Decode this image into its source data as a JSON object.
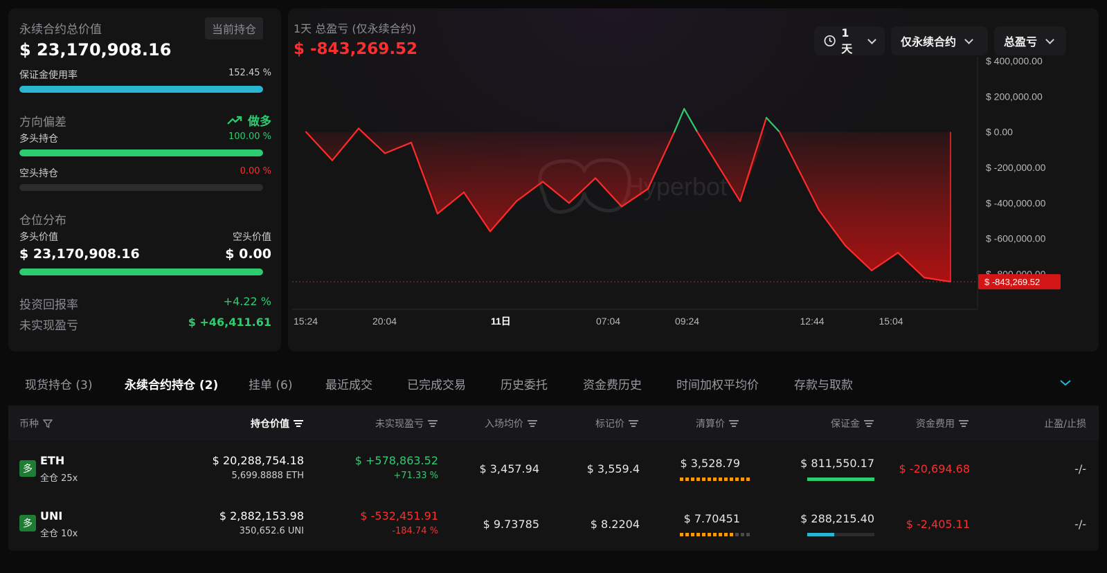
{
  "summary": {
    "total_value_label": "永续合约总价值",
    "current_position_tag": "当前持仓",
    "total_value": "$ 23,170,908.16",
    "margin_usage_label": "保证金使用率",
    "margin_usage_value": "152.45 %",
    "margin_usage_fill": 1.0,
    "bias_label": "方向偏差",
    "bias_value": "做多",
    "long_label": "多头持仓",
    "long_pct": "100.00 %",
    "long_fill": 1.0,
    "short_label": "空头持仓",
    "short_pct": "0.00 %",
    "short_fill": 0.0,
    "distribution_label": "仓位分布",
    "long_value_label": "多头价值",
    "short_value_label": "空头价值",
    "long_value": "$ 23,170,908.16",
    "short_value": "$ 0.00",
    "distribution_fill": 1.0,
    "roi_label": "投资回报率",
    "roi_value": "+4.22 %",
    "upnl_label": "未实现盈亏",
    "upnl_value": "$ +46,411.61"
  },
  "chart_header": {
    "subtitle": "1天 总盈亏 (仅永续合约)",
    "pnl_value": "$ -843,269.52",
    "period_label": "1天",
    "scope_label": "仅永续合约",
    "metric_label": "总盈亏",
    "watermark": "Hyperbot",
    "current_marker": "$ -843,269.52"
  },
  "chart_data": {
    "type": "area",
    "title": "1天 总盈亏 (仅永续合约)",
    "ylim": [
      -800000,
      400000
    ],
    "y_ticks": [
      "$ 400,000.00",
      "$ 200,000.00",
      "$ 0.00",
      "$ -200,000.00",
      "$ -400,000.00",
      "$ -600,000.00",
      "$ -800,000.00"
    ],
    "y_tick_values": [
      400000,
      200000,
      0,
      -200000,
      -400000,
      -600000,
      -800000
    ],
    "x_ticks": [
      "15:24",
      "20:04",
      "11日",
      "07:04",
      "09:24",
      "12:44",
      "15:04"
    ],
    "x_tick_positions": [
      0,
      0.12,
      0.3,
      0.46,
      0.58,
      0.77,
      0.89
    ],
    "baseline": -843269.52,
    "points": [
      {
        "x": 0.0,
        "y": 0
      },
      {
        "x": 0.04,
        "y": -160000
      },
      {
        "x": 0.08,
        "y": 20000
      },
      {
        "x": 0.12,
        "y": -120000
      },
      {
        "x": 0.16,
        "y": -60000
      },
      {
        "x": 0.2,
        "y": -460000
      },
      {
        "x": 0.24,
        "y": -340000
      },
      {
        "x": 0.28,
        "y": -560000
      },
      {
        "x": 0.32,
        "y": -390000
      },
      {
        "x": 0.36,
        "y": -280000
      },
      {
        "x": 0.4,
        "y": -400000
      },
      {
        "x": 0.44,
        "y": -260000
      },
      {
        "x": 0.48,
        "y": -420000
      },
      {
        "x": 0.52,
        "y": -320000
      },
      {
        "x": 0.56,
        "y": 0
      },
      {
        "x": 0.575,
        "y": 130000
      },
      {
        "x": 0.595,
        "y": 0
      },
      {
        "x": 0.66,
        "y": -390000
      },
      {
        "x": 0.7,
        "y": 80000
      },
      {
        "x": 0.72,
        "y": 0
      },
      {
        "x": 0.78,
        "y": -440000
      },
      {
        "x": 0.82,
        "y": -640000
      },
      {
        "x": 0.86,
        "y": -780000
      },
      {
        "x": 0.9,
        "y": -680000
      },
      {
        "x": 0.94,
        "y": -820000
      },
      {
        "x": 0.98,
        "y": -843269.52
      }
    ]
  },
  "tabs": [
    {
      "label": "现货持仓 (3)"
    },
    {
      "label": "永续合约持仓 (2)"
    },
    {
      "label": "挂单 (6)"
    },
    {
      "label": "最近成交"
    },
    {
      "label": "已完成交易"
    },
    {
      "label": "历史委托"
    },
    {
      "label": "资金费历史"
    },
    {
      "label": "时间加权平均价"
    },
    {
      "label": "存款与取款"
    }
  ],
  "table": {
    "headers": {
      "coin": "币种",
      "position_value": "持仓价值",
      "upnl": "未实现盈亏",
      "entry": "入场均价",
      "mark": "标记价",
      "liq": "清算价",
      "margin": "保证金",
      "funding": "资金费用",
      "tpsl": "止盈/止损"
    },
    "rows": [
      {
        "side": "多",
        "coin": "ETH",
        "mode": "全仓 25x",
        "value": "$ 20,288,754.18",
        "size": "5,699.8888 ETH",
        "upnl": "$ +578,863.52",
        "upnl_pct": "+71.33 %",
        "entry": "$ 3,457.94",
        "mark": "$ 3,559.4",
        "liq": "$ 3,528.79",
        "liq_level": 1.0,
        "margin": "$ 811,550.17",
        "margin_fill": 1.0,
        "funding": "$ -20,694.68",
        "tpsl": "-/-"
      },
      {
        "side": "多",
        "coin": "UNI",
        "mode": "全仓 10x",
        "value": "$ 2,882,153.98",
        "size": "350,652.6 UNI",
        "upnl": "$ -532,451.91",
        "upnl_pct": "-184.74 %",
        "entry": "$ 9.73785",
        "mark": "$ 8.2204",
        "liq": "$ 7.70451",
        "liq_level": 0.8,
        "margin": "$ 288,215.40",
        "margin_fill": 0.4,
        "funding": "$ -2,405.11",
        "tpsl": "-/-"
      }
    ]
  },
  "colors": {
    "positive": "#2ecc71",
    "negative": "#ff2d2d",
    "accent_cyan": "#29b6d1"
  }
}
